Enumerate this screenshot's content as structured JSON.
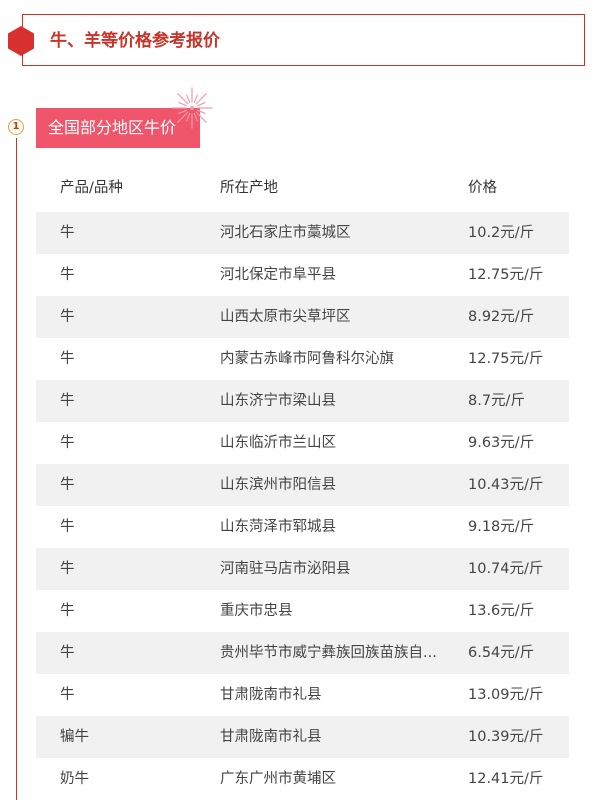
{
  "page": {
    "title": "牛、羊等价格参考报价",
    "accent_color": "#c8342a",
    "tag_color": "#f0566b"
  },
  "section": {
    "step": "1",
    "title": "全国部分地区牛价",
    "decoration_icon": "firework-icon"
  },
  "table": {
    "headers": [
      "产品/品种",
      "所在产地",
      "价格"
    ],
    "rows": [
      [
        "牛",
        "河北石家庄市藁城区",
        "10.2元/斤"
      ],
      [
        "牛",
        "河北保定市阜平县",
        "12.75元/斤"
      ],
      [
        "牛",
        "山西太原市尖草坪区",
        "8.92元/斤"
      ],
      [
        "牛",
        "内蒙古赤峰市阿鲁科尔沁旗",
        "12.75元/斤"
      ],
      [
        "牛",
        "山东济宁市梁山县",
        "8.7元/斤"
      ],
      [
        "牛",
        "山东临沂市兰山区",
        "9.63元/斤"
      ],
      [
        "牛",
        "山东滨州市阳信县",
        "10.43元/斤"
      ],
      [
        "牛",
        "山东菏泽市郓城县",
        "9.18元/斤"
      ],
      [
        "牛",
        "河南驻马店市泌阳县",
        "10.74元/斤"
      ],
      [
        "牛",
        "重庆市忠县",
        "13.6元/斤"
      ],
      [
        "牛",
        "贵州毕节市威宁彝族回族苗族自...",
        "6.54元/斤"
      ],
      [
        "牛",
        "甘肃陇南市礼县",
        "13.09元/斤"
      ],
      [
        "犏牛",
        "甘肃陇南市礼县",
        "10.39元/斤"
      ],
      [
        "奶牛",
        "广东广州市黄埔区",
        "12.41元/斤"
      ]
    ]
  }
}
